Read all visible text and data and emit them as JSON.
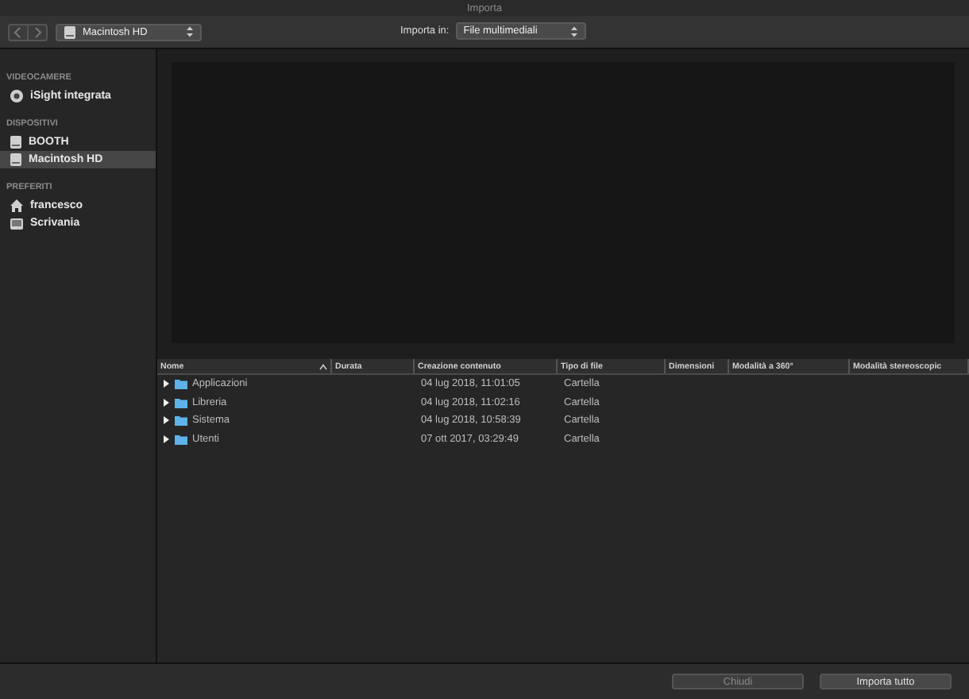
{
  "window": {
    "title": "Importa"
  },
  "toolbar": {
    "location": "Macintosh HD",
    "import_label": "Importa in:",
    "import_target": "File multimediali"
  },
  "sidebar": {
    "sections": [
      {
        "title": "VIDEOCAMERE",
        "items": [
          {
            "label": "iSight integrata",
            "kind": "camera",
            "selected": false
          }
        ]
      },
      {
        "title": "DISPOSITIVI",
        "items": [
          {
            "label": "BOOTH",
            "kind": "drive",
            "selected": false
          },
          {
            "label": "Macintosh HD",
            "kind": "drive",
            "selected": true
          }
        ]
      },
      {
        "title": "PREFERITI",
        "items": [
          {
            "label": "francesco",
            "kind": "home",
            "selected": false
          },
          {
            "label": "Scrivania",
            "kind": "desktop",
            "selected": false
          }
        ]
      }
    ]
  },
  "table": {
    "columns": [
      {
        "label": "Nome",
        "sorted": true
      },
      {
        "label": "Durata",
        "sorted": false
      },
      {
        "label": "Creazione contenuto",
        "sorted": false
      },
      {
        "label": "Tipo di file",
        "sorted": false
      },
      {
        "label": "Dimensioni",
        "sorted": false
      },
      {
        "label": "Modalità a 360°",
        "sorted": false
      },
      {
        "label": "Modalità stereoscopic",
        "sorted": false
      }
    ],
    "rows": [
      {
        "name": "Applicazioni",
        "created": "04 lug 2018, 11:01:05",
        "type": "Cartella",
        "expanded": false
      },
      {
        "name": "Libreria",
        "created": "04 lug 2018, 11:02:16",
        "type": "Cartella",
        "expanded": false
      },
      {
        "name": "Sistema",
        "created": "04 lug 2018, 10:58:39",
        "type": "Cartella",
        "expanded": false
      },
      {
        "name": "Utenti",
        "created": "07 ott 2017, 03:29:49",
        "type": "Cartella",
        "expanded": false
      }
    ]
  },
  "footer": {
    "buttons": [
      {
        "label": "Chiudi",
        "disabled": true
      },
      {
        "label": "Importa tutto",
        "disabled": false
      }
    ]
  }
}
